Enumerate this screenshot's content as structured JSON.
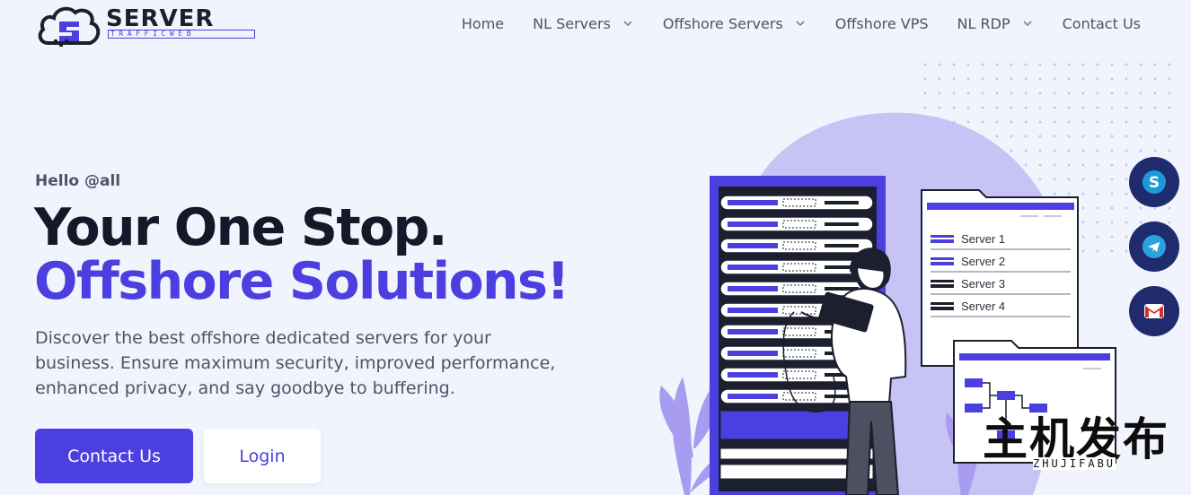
{
  "brand": {
    "name": "SERVER",
    "sub": "TRAFFICWEB",
    "accent": "#4b3fe0",
    "dark": "#1c1f2e"
  },
  "nav": {
    "items": [
      {
        "label": "Home",
        "dropdown": false
      },
      {
        "label": "NL Servers",
        "dropdown": true
      },
      {
        "label": "Offshore Servers",
        "dropdown": true
      },
      {
        "label": "Offshore VPS",
        "dropdown": false
      },
      {
        "label": "NL RDP",
        "dropdown": true
      },
      {
        "label": "Contact Us",
        "dropdown": false
      }
    ]
  },
  "hero": {
    "greeting": "Hello @all",
    "headline_1": "Your One Stop.",
    "headline_2": "Offshore Solutions!",
    "description": "Discover the best offshore dedicated servers for your business. Ensure maximum security, improved performance, enhanced privacy, and say goodbye to buffering.",
    "cta_primary": "Contact Us",
    "cta_secondary": "Login"
  },
  "illustration": {
    "server_list": [
      "Server 1",
      "Server 2",
      "Server 3",
      "Server 4"
    ]
  },
  "floating_contacts": [
    {
      "name": "skype",
      "icon": "skype-icon",
      "color": "#1a9bd7"
    },
    {
      "name": "telegram",
      "icon": "telegram-icon",
      "color": "#2aa3dd"
    },
    {
      "name": "gmail",
      "icon": "gmail-icon",
      "color": "#d93025"
    }
  ],
  "watermark": {
    "text": "主机发布",
    "sub": "ZHUJIFABU"
  }
}
